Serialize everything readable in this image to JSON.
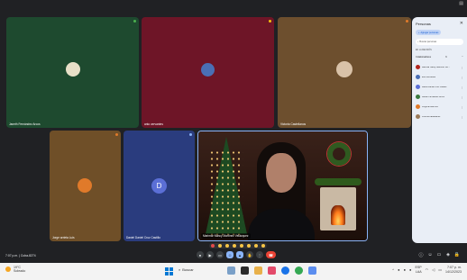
{
  "participants": [
    {
      "name": "Janeth Fernández Arcos",
      "bg": "#1e4a2f",
      "avatar_color": "#3a7a40"
    },
    {
      "name": "anto cervantes",
      "bg": "#6e1527",
      "avatar_color": "#4a6fb5"
    },
    {
      "name": "Victoria Castellanos",
      "bg": "#6d4f2e",
      "avatar_color": "#d9c2a8"
    },
    {
      "name": "Jorge arrieta Luis",
      "bg": "#6f4f28",
      "avatar_color": "#e07a2a"
    },
    {
      "name": "Daniel Daniel Cruz Castillo",
      "bg": "#2a3c7e",
      "avatar_letter": "D",
      "avatar_color": "#5b6fd6"
    },
    {
      "name": "Marimar Nancy Martínez Velázquez",
      "bg": "#3b1e16"
    }
  ],
  "meeting": {
    "time_code": "7:07 p.m. | Cuba-8274"
  },
  "controls": {
    "mic_icon": "mic-icon",
    "cam_icon": "camera-icon",
    "captions_icon": "captions-icon",
    "present_icon": "present-icon",
    "more_icon": "more-icon",
    "end_icon": "end-call-icon"
  },
  "panel": {
    "title": "Personas",
    "add_label": "Agregar personas",
    "search_placeholder": "Buscar personas",
    "section_label": "EN LA REUNIÓN",
    "group_label": "Colaboradores",
    "group_count": "6",
    "people": [
      {
        "name": "Marimar Nancy Martínez Vel…",
        "color": "#b3261e"
      },
      {
        "name": "anto cervantes",
        "color": "#4a6fb5"
      },
      {
        "name": "Daniel Daniel Cruz Castillo",
        "color": "#5b6fd6"
      },
      {
        "name": "Janeth Fernández Arcos",
        "color": "#3a7a40"
      },
      {
        "name": "Jorge arrieta Luis",
        "color": "#e07a2a"
      },
      {
        "name": "Victoria Castellanos",
        "color": "#9a7b5b"
      }
    ]
  },
  "taskbar": {
    "temp": "19°C",
    "weather": "Soleado",
    "search": "Buscar",
    "lang": "ESP",
    "region": "LAA",
    "time": "7:07 p. m.",
    "date": "14/12/2023"
  }
}
